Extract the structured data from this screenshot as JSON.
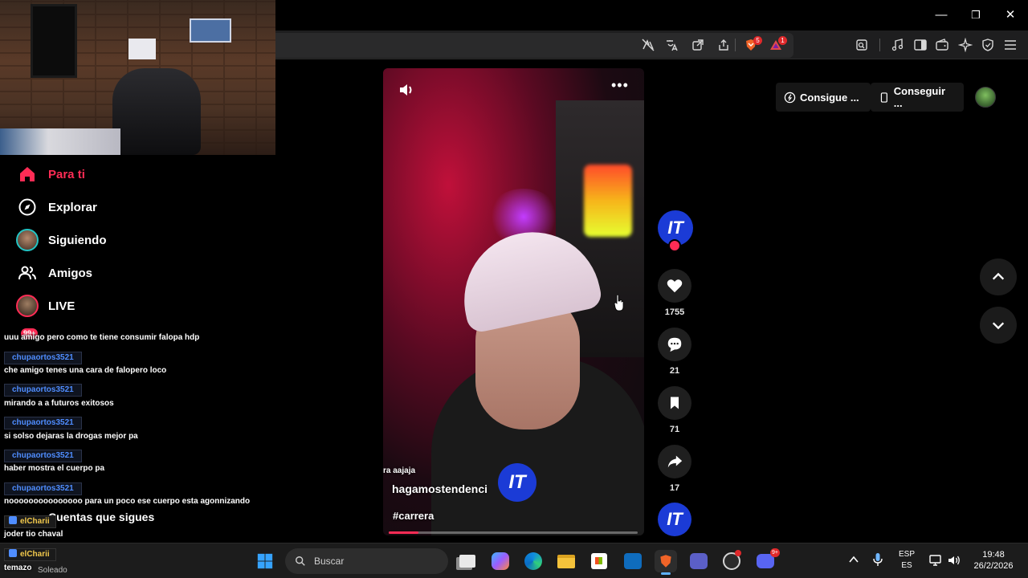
{
  "window": {
    "minimize_glyph": "—",
    "maximize_glyph": "❐",
    "close_glyph": "✕"
  },
  "toolbar": {
    "brave_badge": "5",
    "alert_badge": "1"
  },
  "sidebar": {
    "items": [
      {
        "label": "Para ti",
        "icon": "home-icon",
        "active": true
      },
      {
        "label": "Explorar",
        "icon": "compass-icon"
      },
      {
        "label": "Siguiendo",
        "icon": "avatar-icon"
      },
      {
        "label": "Amigos",
        "icon": "friends-icon"
      },
      {
        "label": "LIVE",
        "icon": "live-avatar-icon"
      }
    ],
    "live_badge": "99+",
    "following_header": "Cuentas que sigues",
    "weather": "Soleado"
  },
  "chat": {
    "messages": [
      {
        "kind": "text",
        "text": "uuu amigo pero como te tiene consumir falopa hdp"
      },
      {
        "kind": "user",
        "text": "chupaortos3521"
      },
      {
        "kind": "text",
        "text": "che amigo tenes una cara de falopero loco"
      },
      {
        "kind": "user",
        "text": "chupaortos3521"
      },
      {
        "kind": "text",
        "text": "mirando a a futuros exitosos"
      },
      {
        "kind": "user",
        "text": "chupaortos3521"
      },
      {
        "kind": "text",
        "text": "si solso dejaras la drogas mejor pa"
      },
      {
        "kind": "user",
        "text": "chupaortos3521"
      },
      {
        "kind": "text",
        "text": "haber mostra el cuerpo pa"
      },
      {
        "kind": "user",
        "text": "chupaortos3521"
      },
      {
        "kind": "text",
        "text": "nooooooooooooooo para un poco ese cuerpo esta agonnizando"
      },
      {
        "kind": "gold",
        "text": "elCharii"
      },
      {
        "kind": "text",
        "text": "joder tio chaval"
      },
      {
        "kind": "gold",
        "text": "elCharii"
      },
      {
        "kind": "text",
        "text": "temazo"
      }
    ]
  },
  "video": {
    "caption_partial": "ra aajaja",
    "author": "hagamostendenci",
    "hashtag": "#carrera",
    "progress": 0.12
  },
  "actions": {
    "likes": "1755",
    "comments": "21",
    "saves": "71",
    "shares": "17",
    "logo_text": "IT"
  },
  "topright": {
    "get_coins": "Consigue ...",
    "get_app": "Conseguir ..."
  },
  "taskbar": {
    "search_placeholder": "Buscar",
    "lang_top": "ESP",
    "lang_bottom": "ES",
    "time": "19:48",
    "date": "26/2/2026",
    "discord_badge": "9+"
  },
  "colors": {
    "accent": "#fe2c55",
    "chat_user": "#4f8dff",
    "gold_user": "#f2c94c"
  }
}
